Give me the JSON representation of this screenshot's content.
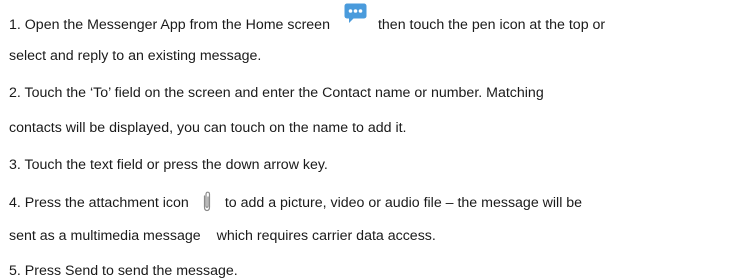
{
  "steps": [
    {
      "line1_before": "1. Open the Messenger App from the Home screen",
      "icon": "messenger-app-icon",
      "line1_after": "then touch the pen icon at the top or",
      "line2": "select and reply to an existing message."
    },
    {
      "line1": "2. Touch the ‘To’ field on the screen and enter the Contact name or number. Matching",
      "line2": "contacts will be displayed, you can touch on the name to add it."
    },
    {
      "line1": "3. Touch the text field or press the down arrow key."
    },
    {
      "line1_before": "4. Press the attachment icon",
      "icon": "paperclip-attachment-icon",
      "line1_after": "to add a picture, video or audio file – the message will be",
      "line2_before": "sent as a multimedia message",
      "line2_after": "which requires carrier data access."
    },
    {
      "line1": "5. Press Send to send the message."
    }
  ],
  "colors": {
    "text": "#1a1a1a",
    "messenger_icon": "#4a9bdc",
    "paperclip": "#8a8a8a"
  }
}
